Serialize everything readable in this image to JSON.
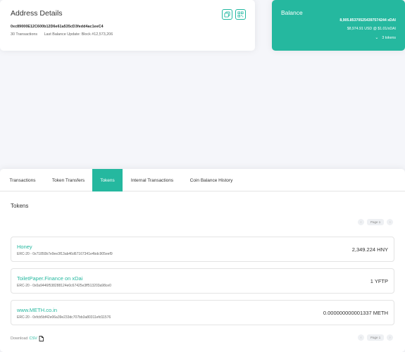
{
  "address": {
    "title": "Address Details",
    "hash": "0xc89000E12C600b12D6e61a535cD3fedd4ac1eeC4",
    "transactions": "30 Transactions",
    "last_update": "Last Balance Update: Block #12,573,206"
  },
  "balance": {
    "title": "Balance",
    "xdai": "8,905.853705254397574244 xDAI",
    "usd": "$8,974.91 USD @ $1.01/xDAI",
    "tokens": "3 tokens"
  },
  "tabs": [
    {
      "label": "Transactions"
    },
    {
      "label": "Token Transfers"
    },
    {
      "label": "Tokens"
    },
    {
      "label": "Internal Transactions"
    },
    {
      "label": "Coin Balance History"
    }
  ],
  "tokens_heading": "Tokens",
  "pager": {
    "page": "Page 1"
  },
  "tokens": [
    {
      "name": "Honey",
      "contract": "ERC-20 - 0x71850b7e9ee3f13ab46d67167341e4bdc905eef9",
      "amount": "2,349.224 HNY"
    },
    {
      "name": "ToiletPaper.Finance on xDai",
      "contract": "ERC-20 - 0x0a9446f538288124e0c67425e3ff513203a98ce0",
      "amount": "1 YFTP"
    },
    {
      "name": "www.METH.co.in",
      "contract": "ERC-20 - 0xfcb5bf42e06a39e233dc707bb3a80311efd11576",
      "amount": "0.000000000001337 METH"
    }
  ],
  "download": {
    "label": "Download",
    "csv": "CSV"
  },
  "colors": {
    "accent": "#25b89f"
  }
}
